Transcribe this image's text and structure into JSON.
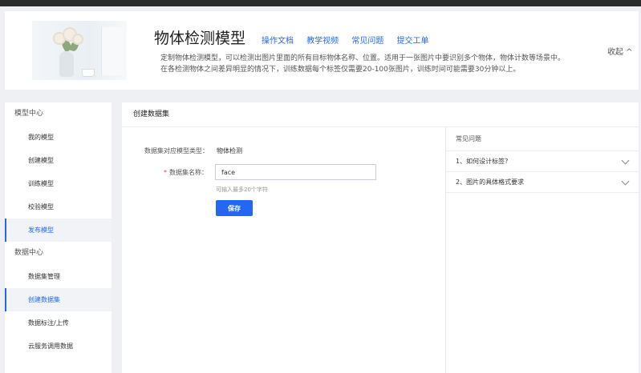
{
  "header": {
    "title": "物体检测模型",
    "links": [
      "操作文档",
      "教学视频",
      "常见问题",
      "提交工单"
    ],
    "description_line1": "定制物体检测模型，可以检测出图片里面的所有目标物体名称、位置。适用于一张图片中要识别多个物体，物体计数等场景中。",
    "description_line2": "在各检测物体之间差异明显的情况下，训练数据每个标签仅需要20-100张图片，训练时间可能需要30分钟以上。",
    "collapse_label": "收起 ^"
  },
  "sidebar": {
    "model_center": "模型中心",
    "model_items": [
      "我的模型",
      "创建模型",
      "训练模型",
      "校验模型",
      "发布模型"
    ],
    "data_center": "数据中心",
    "data_items": [
      "数据集管理",
      "创建数据集",
      "数据标注/上传",
      "云服务调用数据"
    ]
  },
  "main": {
    "title": "创建数据集",
    "type_label": "数据集对应模型类型：",
    "type_value": "物体检测",
    "name_label": "数据集名称：",
    "name_value": "face",
    "hint": "可输入最多20个字符",
    "save_label": "保存"
  },
  "faq": {
    "title": "常见问题",
    "items": [
      "1、如何设计标签?",
      "2、图片的具体格式要求"
    ]
  },
  "colors": {
    "accent": "#2468f2",
    "required": "#f33e3e",
    "page_bg": "#eef0f3"
  }
}
